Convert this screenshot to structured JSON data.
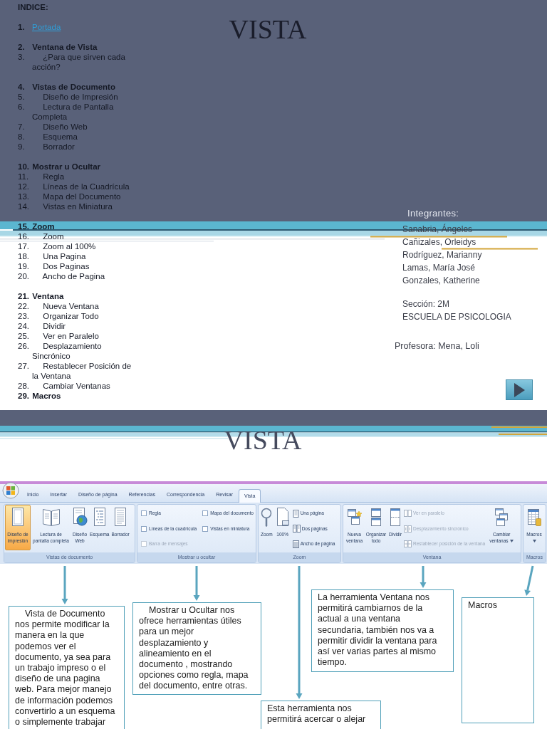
{
  "slide_1": {
    "title": "VISTA",
    "index": {
      "heading": "INDICE:",
      "groups": [
        [
          {
            "kind": "link",
            "number": "1.",
            "text": "Portada"
          }
        ],
        [
          {
            "kind": "heading",
            "number": "2.",
            "text": "Ventana de Vista"
          },
          {
            "kind": "item",
            "number": "3.",
            "text": "¿Para que sirven cada acción?"
          }
        ],
        [
          {
            "kind": "heading",
            "number": "4.",
            "text": "Vistas de Documento"
          },
          {
            "kind": "item",
            "number": "5.",
            "text": "Diseño de Impresión"
          },
          {
            "kind": "item",
            "number": "6.",
            "text": "Lectura de Pantalla Completa"
          },
          {
            "kind": "item",
            "number": "7.",
            "text": "Diseño Web"
          },
          {
            "kind": "item",
            "number": "8.",
            "text": "Esquema"
          },
          {
            "kind": "item",
            "number": "9.",
            "text": "Borrador"
          }
        ],
        [
          {
            "kind": "heading",
            "number": "10.",
            "text": "Mostrar u Ocultar"
          },
          {
            "kind": "item",
            "number": "11.",
            "text": "Regla"
          },
          {
            "kind": "item",
            "number": "12.",
            "text": "Líneas de la Cuadrícula"
          },
          {
            "kind": "item",
            "number": "13.",
            "text": "Mapa del Documento"
          },
          {
            "kind": "item",
            "number": "14.",
            "text": "Vistas en Miniatura"
          }
        ],
        [
          {
            "kind": "heading",
            "number": "15.",
            "text": "Zoom"
          },
          {
            "kind": "item",
            "number": "16.",
            "text": "Zoom"
          },
          {
            "kind": "item",
            "number": "17.",
            "text": "Zoom al 100%"
          },
          {
            "kind": "item",
            "number": "18.",
            "text": "Una Pagina"
          },
          {
            "kind": "item",
            "number": "19.",
            "text": "Dos Paginas"
          },
          {
            "kind": "item",
            "number": "20.",
            "text": "Ancho de Pagina"
          }
        ],
        [
          {
            "kind": "heading",
            "number": "21.",
            "text": "Ventana"
          },
          {
            "kind": "item",
            "number": "22.",
            "text": "Nueva Ventana"
          },
          {
            "kind": "item",
            "number": "23.",
            "text": "Organizar Todo"
          },
          {
            "kind": "item",
            "number": "24.",
            "text": "Dividir"
          },
          {
            "kind": "item",
            "number": "25.",
            "text": "Ver en Paralelo"
          },
          {
            "kind": "item",
            "number": "26.",
            "text": "Desplazamiento Sincrónico"
          },
          {
            "kind": "item",
            "number": "27.",
            "text": "Restablecer Posición de la Ventana"
          },
          {
            "kind": "item",
            "number": "28.",
            "text": "Cambiar Ventanas"
          },
          {
            "kind": "heading",
            "number": "29.",
            "text": "Macros"
          }
        ]
      ]
    },
    "members_label": "Integrantes:",
    "members": [
      "Sanabria, Ángeles",
      "Cañizales, Orleidys",
      "Rodríguez, Marianny",
      "Lamas, María José",
      "Gonzales, Katherine"
    ],
    "section": "Sección: 2M",
    "school": "ESCUELA DE PSICOLOGIA",
    "teacher": "Profesora: Mena, Loli"
  },
  "slide_2": {
    "title": "VISTA",
    "ribbon": {
      "tabs": [
        {
          "label": "Inicio",
          "selected": false
        },
        {
          "label": "Insertar",
          "selected": false
        },
        {
          "label": "Diseño de página",
          "selected": false
        },
        {
          "label": "Referencias",
          "selected": false
        },
        {
          "label": "Correspondencia",
          "selected": false
        },
        {
          "label": "Revisar",
          "selected": false
        },
        {
          "label": "Vista",
          "selected": true
        }
      ],
      "groups": [
        {
          "label": "Vistas de documento",
          "controls": [
            {
              "kind": "large",
              "label": "Diseño de impresión",
              "selected": true
            },
            {
              "kind": "large",
              "label": "Lectura de pantalla completa",
              "selected": false
            },
            {
              "kind": "large",
              "label": "Diseño Web",
              "selected": false
            },
            {
              "kind": "large",
              "label": "Esquema",
              "selected": false
            },
            {
              "kind": "large",
              "label": "Borrador",
              "selected": false
            }
          ]
        },
        {
          "label": "Mostrar u ocultar",
          "controls": [
            {
              "kind": "checkbox",
              "label": "Regla",
              "checked": false,
              "disabled": false
            },
            {
              "kind": "checkbox",
              "label": "Mapa del documento",
              "checked": false,
              "disabled": false
            },
            {
              "kind": "checkbox",
              "label": "Líneas de la cuadrícula",
              "checked": false,
              "disabled": false
            },
            {
              "kind": "checkbox",
              "label": "Vistas en miniatura",
              "checked": false,
              "disabled": false
            },
            {
              "kind": "checkbox",
              "label": "Barra de mensajes",
              "checked": false,
              "disabled": true
            }
          ]
        },
        {
          "label": "Zoom",
          "controls": [
            {
              "kind": "large",
              "label": "Zoom"
            },
            {
              "kind": "large",
              "label": "100%"
            },
            {
              "kind": "small",
              "label": "Una página",
              "disabled": false
            },
            {
              "kind": "small",
              "label": "Dos páginas",
              "disabled": false
            },
            {
              "kind": "small",
              "label": "Ancho de página",
              "disabled": false
            }
          ]
        },
        {
          "label": "Ventana",
          "controls": [
            {
              "kind": "large",
              "label": "Nueva ventana",
              "dropdown": false
            },
            {
              "kind": "large",
              "label": "Organizar todo",
              "dropdown": false
            },
            {
              "kind": "large",
              "label": "Dividir",
              "dropdown": false
            },
            {
              "kind": "small",
              "label": "Ver en paralelo",
              "disabled": true
            },
            {
              "kind": "small",
              "label": "Desplazamiento sincrónico",
              "disabled": true
            },
            {
              "kind": "small",
              "label": "Restablecer posición de la ventana",
              "disabled": true
            },
            {
              "kind": "large",
              "label": "Cambiar ventanas",
              "dropdown": true
            }
          ]
        },
        {
          "label": "Macros",
          "controls": [
            {
              "kind": "large",
              "label": "Macros",
              "dropdown": true
            }
          ]
        }
      ]
    },
    "callouts": [
      {
        "text": "Vista de Documento nos permite modificar la manera en la que podemos ver el documento, ya sea para un trabajo impreso o el diseño de una pagina web. Para mejor manejo de información podemos convertirlo a un esquema o simplemente trabajar",
        "first_line_indent": true
      },
      {
        "text": "Mostrar u Ocultar nos ofrece herramientas útiles para un mejor desplazamiento y alineamiento en el documento , mostrando opciones como regla, mapa del documento, entre otras.",
        "first_line_indent": true
      },
      {
        "text": "Esta herramienta nos permitirá acercar o alejar",
        "first_line_indent": false
      },
      {
        "text": "La herramienta Ventana nos permitirá cambiarnos de la actual a una ventana secundaria, también nos va a permitir dividir la ventana para así ver varias partes al mismo tiempo.",
        "first_line_indent": false
      },
      {
        "text": "Macros",
        "first_line_indent": false
      }
    ]
  }
}
